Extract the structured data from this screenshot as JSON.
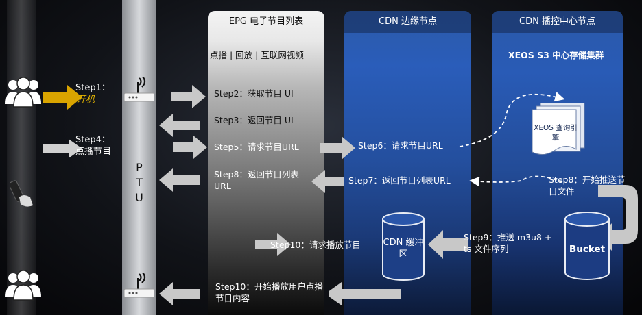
{
  "columns": {
    "epg": {
      "title": "EPG 电子节目列表",
      "subtitle": "点播 | 回放 | 互联网视频"
    },
    "cdn_edge": {
      "title": "CDN 边缘节点"
    },
    "cdn_center": {
      "title": "CDN 播控中心节点",
      "subtitle": "XEOS S3 中心存储集群"
    }
  },
  "ptu": {
    "letters": [
      "P",
      "T",
      "U"
    ]
  },
  "steps": {
    "step1": {
      "label": "Step1：",
      "action": "开机"
    },
    "step4": {
      "label": "Step4：",
      "action": "点播节目"
    },
    "step2": "Step2：获取节目 UI",
    "step3": "Step3：返回节目 UI",
    "step5": "Step5：请求节目URL",
    "step6": "Step6：请求节目URL",
    "step7": "Step7：返回节目列表URL",
    "step8a": "Step8：返回节目列表URL",
    "step8b": "Step8：开始推送节目文件",
    "step9": "Step9：推送 m3u8 + ts 文件序列",
    "step10a": "Step10：请求播放节目",
    "step10b": "Step10：开始播放用户点播节目内容"
  },
  "nodes": {
    "query_engine": "XEOS 查询引擎",
    "cdn_buffer": "CDN 缓冲区",
    "bucket": "Bucket"
  },
  "colors": {
    "edge_blue": "#2a5dba",
    "center_blue": "#295bb6",
    "step1_accent": "#d9a400"
  }
}
